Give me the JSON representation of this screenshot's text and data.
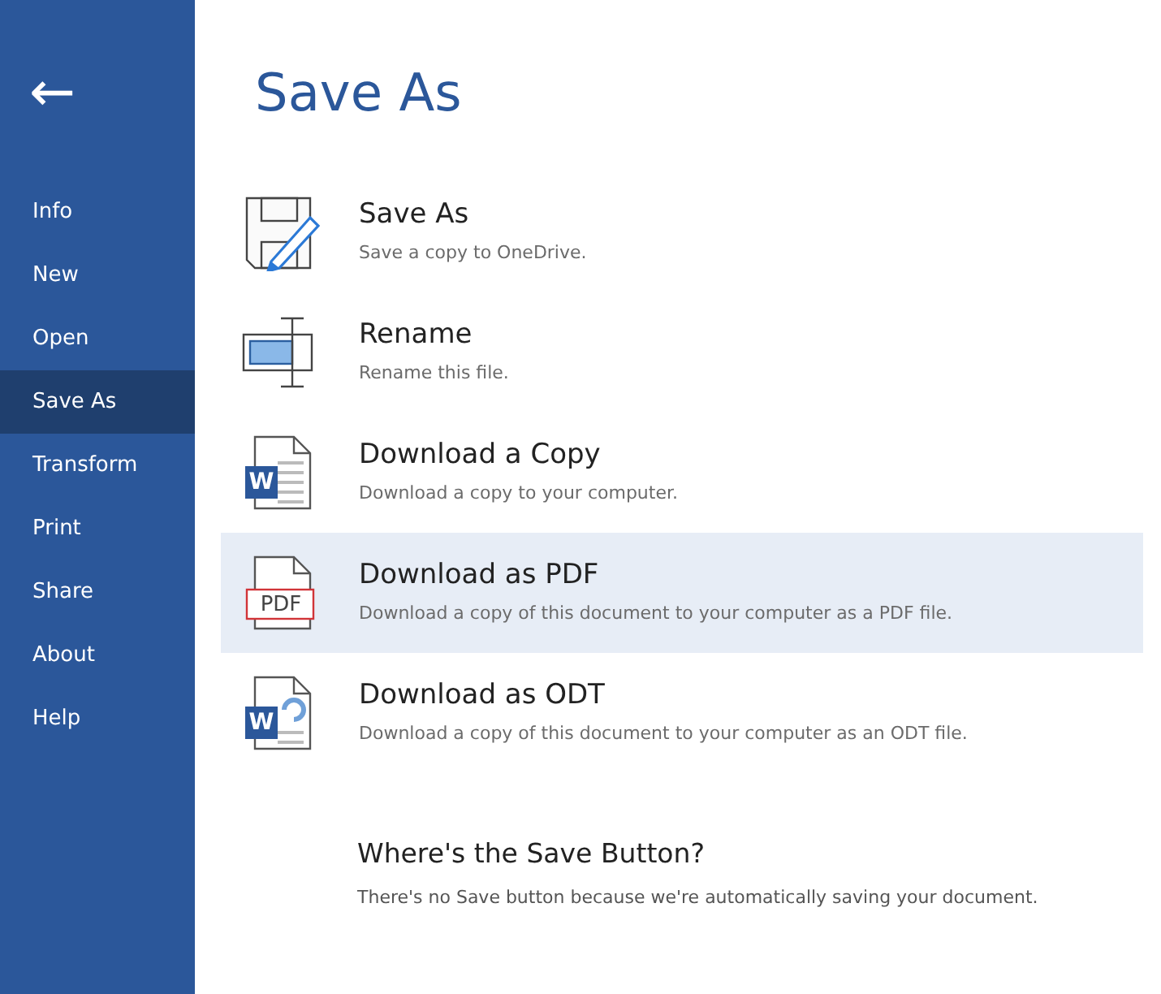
{
  "sidebar": {
    "back": "←",
    "items": [
      {
        "label": "Info",
        "selected": false
      },
      {
        "label": "New",
        "selected": false
      },
      {
        "label": "Open",
        "selected": false
      },
      {
        "label": "Save As",
        "selected": true
      },
      {
        "label": "Transform",
        "selected": false
      },
      {
        "label": "Print",
        "selected": false
      },
      {
        "label": "Share",
        "selected": false
      },
      {
        "label": "About",
        "selected": false
      },
      {
        "label": "Help",
        "selected": false
      }
    ]
  },
  "title": "Save As",
  "options": [
    {
      "kind": "save",
      "title": "Save As",
      "description": "Save a copy to OneDrive.",
      "selected": false
    },
    {
      "kind": "rename",
      "title": "Rename",
      "description": "Rename this file.",
      "selected": false
    },
    {
      "kind": "word",
      "icon_text": "W",
      "title": "Download a Copy",
      "description": "Download a copy to your computer.",
      "selected": false
    },
    {
      "kind": "pdf",
      "icon_text": "PDF",
      "title": "Download as PDF",
      "description": "Download a copy of this document to your computer as a PDF file.",
      "selected": true
    },
    {
      "kind": "odt",
      "icon_text": "W",
      "title": "Download as ODT",
      "description": "Download a copy of this document to your computer as an ODT file.",
      "selected": false
    }
  ],
  "help": {
    "heading": "Where's the Save Button?",
    "text": "There's no Save button because we're automatically saving your document."
  }
}
